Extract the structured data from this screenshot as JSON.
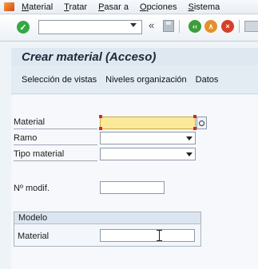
{
  "menu": {
    "items": [
      "Material",
      "Tratar",
      "Pasar a",
      "Opciones",
      "Sistema"
    ]
  },
  "toolbar": {
    "ok_symbol": "✓",
    "command_field_value": "",
    "double_arrow": "«",
    "back_symbol": "‹‹",
    "exit_symbol": "∧",
    "cancel_symbol": "×"
  },
  "title": "Crear material (Acceso)",
  "app_toolbar": {
    "items": [
      "Selección de vistas",
      "Niveles organización",
      "Datos"
    ]
  },
  "form": {
    "material": {
      "label": "Material",
      "value": ""
    },
    "ramo": {
      "label": "Ramo",
      "value": ""
    },
    "tipo_material": {
      "label": "Tipo material",
      "value": ""
    },
    "num_modif": {
      "label": "Nº modif.",
      "value": ""
    }
  },
  "modelo": {
    "title": "Modelo",
    "material_label": "Material",
    "material_value": ""
  },
  "colors": {
    "required_field": "#fde99a",
    "title_bg": "#dfe8f1",
    "ok_green": "#33a744",
    "cancel_red": "#d6402a",
    "exit_orange": "#e5902a"
  }
}
